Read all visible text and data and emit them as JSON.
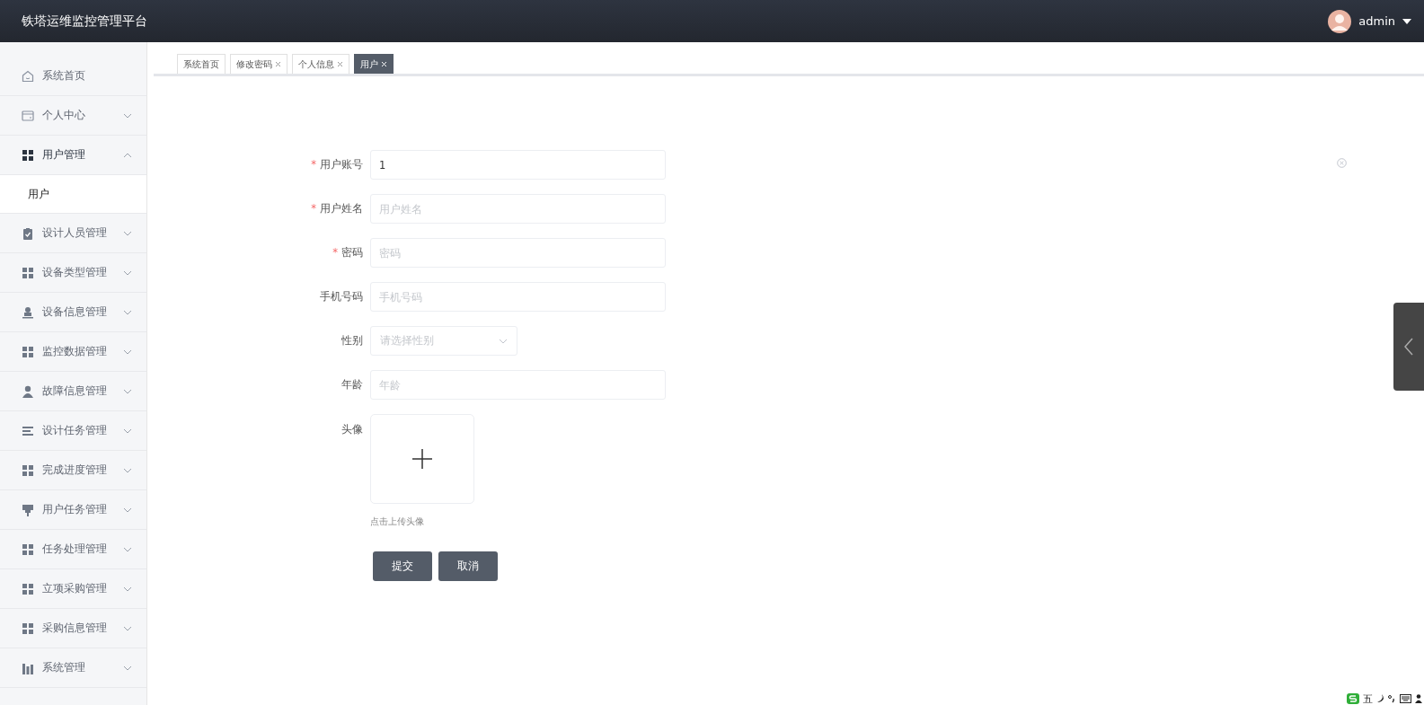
{
  "header": {
    "title": "铁塔运维监控管理平台",
    "user": "admin"
  },
  "sidebar": {
    "items": [
      {
        "label": "系统首页",
        "kind": "home",
        "expandable": false
      },
      {
        "label": "个人中心",
        "kind": "card",
        "expandable": true,
        "expanded": false
      },
      {
        "label": "用户管理",
        "kind": "grid",
        "expandable": true,
        "expanded": true,
        "children": [
          {
            "label": "用户",
            "selected": true
          }
        ]
      },
      {
        "label": "设计人员管理",
        "kind": "clipboard",
        "expandable": true,
        "expanded": false
      },
      {
        "label": "设备类型管理",
        "kind": "grid",
        "expandable": true,
        "expanded": false
      },
      {
        "label": "设备信息管理",
        "kind": "stamp",
        "expandable": true,
        "expanded": false
      },
      {
        "label": "监控数据管理",
        "kind": "grid",
        "expandable": true,
        "expanded": false
      },
      {
        "label": "故障信息管理",
        "kind": "person",
        "expandable": true,
        "expanded": false
      },
      {
        "label": "设计任务管理",
        "kind": "list",
        "expandable": true,
        "expanded": false
      },
      {
        "label": "完成进度管理",
        "kind": "grid",
        "expandable": true,
        "expanded": false
      },
      {
        "label": "用户任务管理",
        "kind": "sign",
        "expandable": true,
        "expanded": false
      },
      {
        "label": "任务处理管理",
        "kind": "grid",
        "expandable": true,
        "expanded": false
      },
      {
        "label": "立项采购管理",
        "kind": "grid",
        "expandable": true,
        "expanded": false
      },
      {
        "label": "采购信息管理",
        "kind": "grid",
        "expandable": true,
        "expanded": false
      },
      {
        "label": "系统管理",
        "kind": "bars",
        "expandable": true,
        "expanded": false
      }
    ]
  },
  "tabs": [
    {
      "label": "系统首页",
      "closable": false,
      "selected": false
    },
    {
      "label": "修改密码",
      "closable": true,
      "selected": false
    },
    {
      "label": "个人信息",
      "closable": true,
      "selected": false
    },
    {
      "label": "用户",
      "closable": true,
      "selected": true
    }
  ],
  "form": {
    "fields": [
      {
        "label": "用户账号",
        "required_mark": "*",
        "kind": "text",
        "value": "1"
      },
      {
        "label": "用户姓名",
        "required_mark": "*",
        "kind": "text",
        "placeholder": "用户姓名"
      },
      {
        "label": "密码",
        "required_mark": "*",
        "kind": "text",
        "placeholder": "密码"
      },
      {
        "label": "手机号码",
        "kind": "text",
        "placeholder": "手机号码"
      },
      {
        "label": "性别",
        "kind": "select",
        "placeholder": "请选择性别"
      },
      {
        "label": "年龄",
        "kind": "text",
        "placeholder": "年龄"
      },
      {
        "label": "头像",
        "kind": "upload",
        "hint": "点击上传头像"
      }
    ],
    "buttons": [
      "提交",
      "取消"
    ]
  },
  "ime_bar": {
    "mode": "五"
  }
}
